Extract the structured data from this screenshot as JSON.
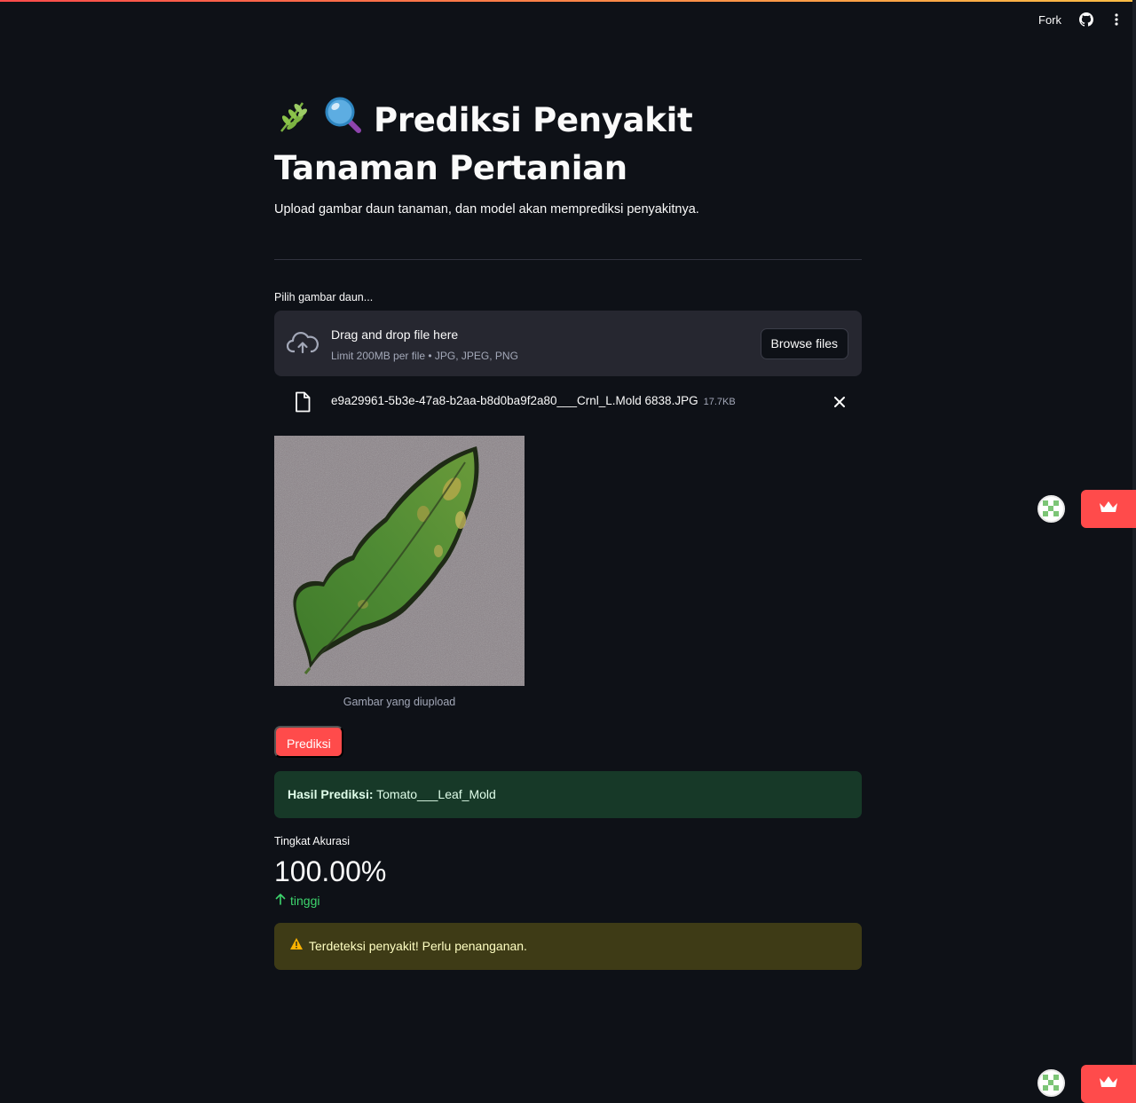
{
  "header": {
    "fork_label": "Fork",
    "github_icon": "github-icon",
    "menu_icon": "kebab-menu-icon"
  },
  "page": {
    "title": "Prediksi Penyakit Tanaman Pertanian",
    "title_emojis": [
      "herb-icon",
      "magnifier-icon"
    ],
    "subtitle": "Upload gambar daun tanaman, dan model akan memprediksi penyakitnya."
  },
  "uploader": {
    "label": "Pilih gambar daun...",
    "drop_text": "Drag and drop file here",
    "limit_text": "Limit 200MB per file • JPG, JPEG, PNG",
    "browse_label": "Browse files",
    "file": {
      "name": "e9a29961-5b3e-47a8-b2aa-b8d0ba9f2a80___Crnl_L.Mold 6838.JPG",
      "size": "17.7KB"
    }
  },
  "image": {
    "caption": "Gambar yang diupload"
  },
  "predict_button": "Prediksi",
  "result": {
    "label": "Hasil Prediksi:",
    "value": "Tomato___Leaf_Mold"
  },
  "metric": {
    "label": "Tingkat Akurasi",
    "value": "100.00%",
    "delta": "tinggi"
  },
  "warning": {
    "text": "Terdeteksi penyakit! Perlu penanganan."
  },
  "colors": {
    "background": "#0e1117",
    "accent": "#ff4b4b",
    "success_bg": "#173928",
    "warning_bg": "#3e3b16",
    "delta_green": "#3dd56d"
  }
}
